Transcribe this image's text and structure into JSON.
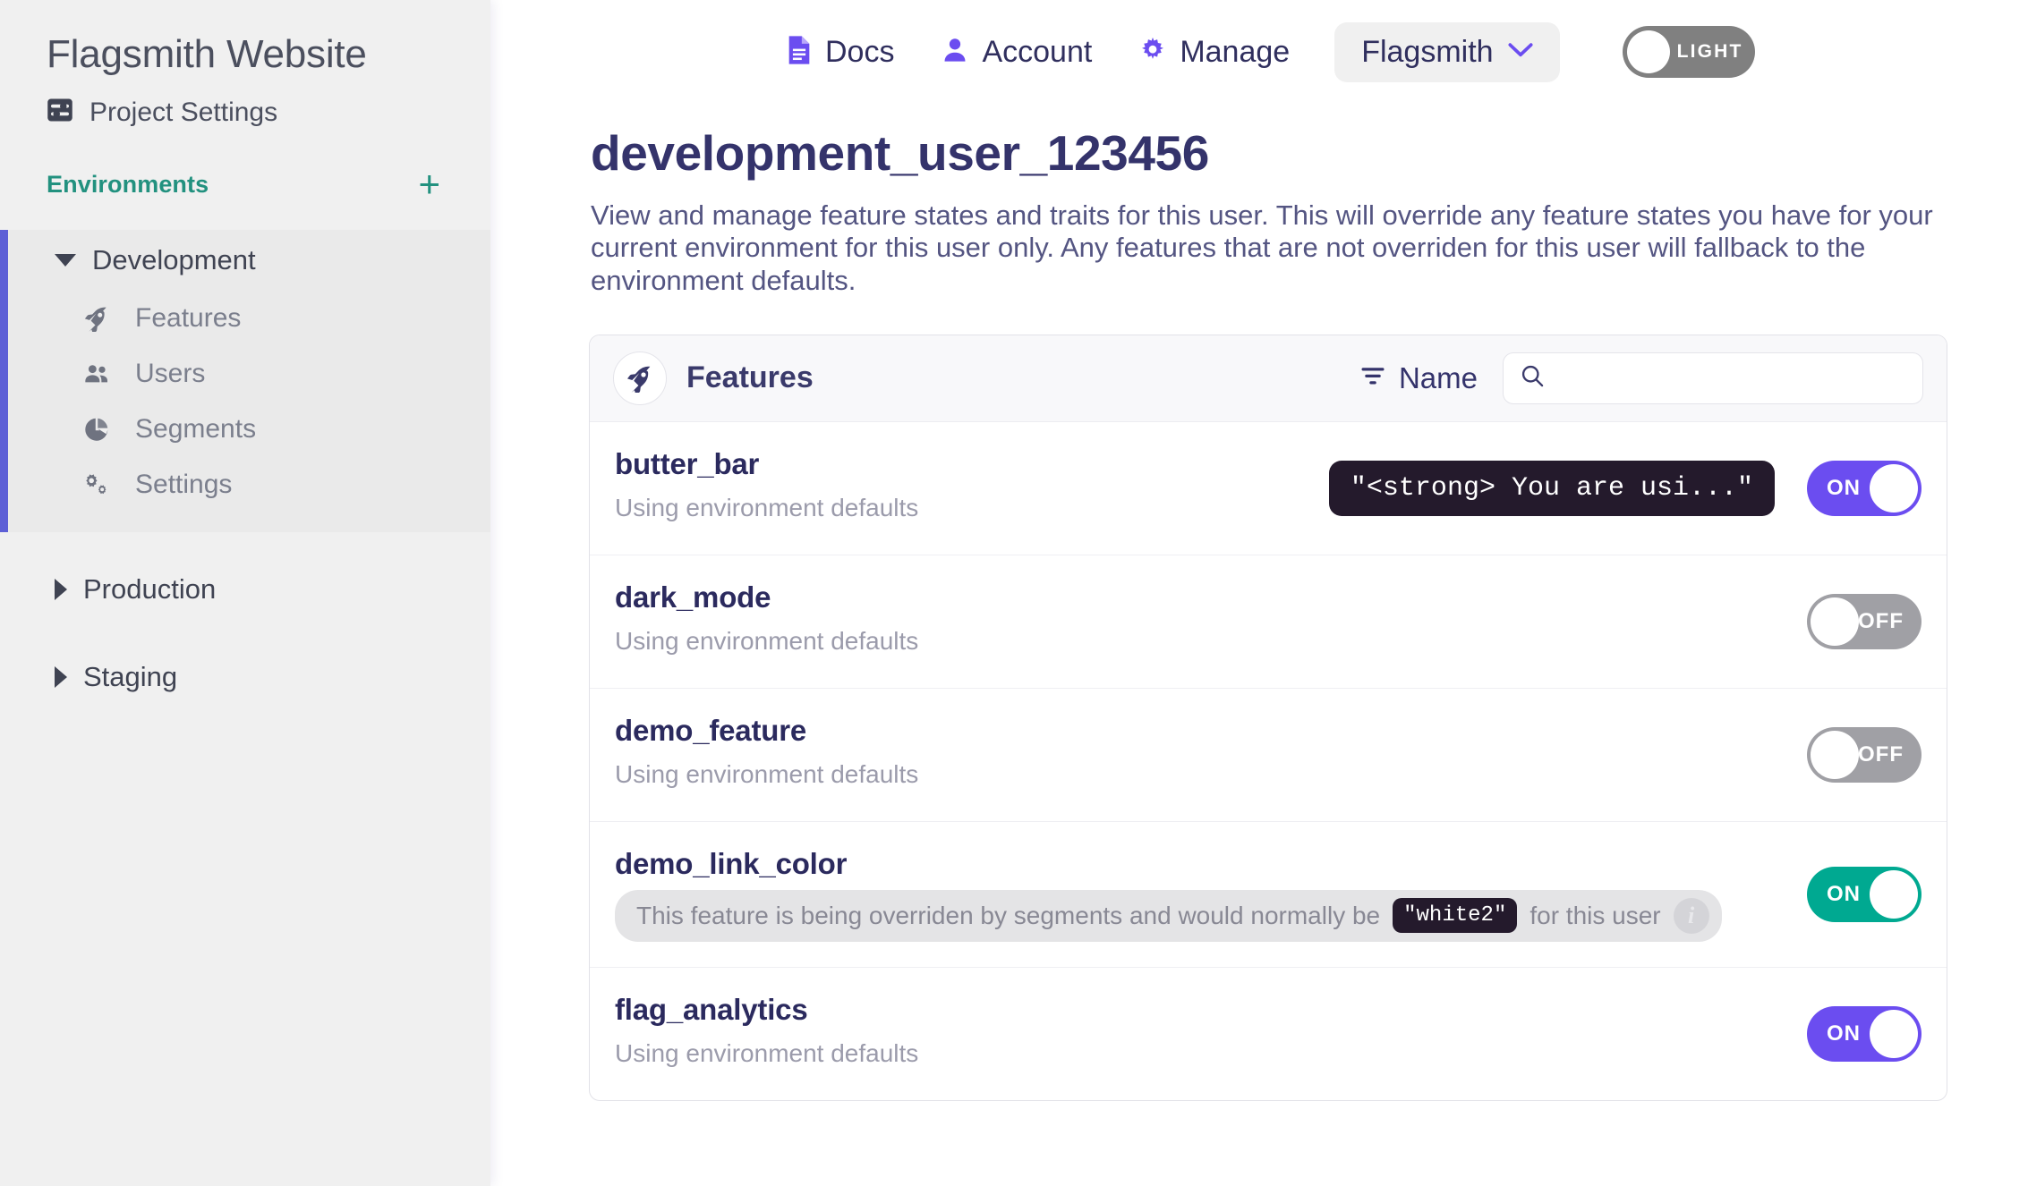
{
  "sidebar": {
    "project_title": "Flagsmith Website",
    "project_settings_label": "Project Settings",
    "project_settings_icon": "sliders-icon",
    "environments_label": "Environments",
    "add_environment_icon": "plus-icon",
    "environments": [
      {
        "name": "Development",
        "expanded": true,
        "active": true,
        "caret_icon": "caret-down-icon",
        "children": [
          {
            "label": "Features",
            "icon": "rocket-icon"
          },
          {
            "label": "Users",
            "icon": "people-icon"
          },
          {
            "label": "Segments",
            "icon": "pie-chart-icon"
          },
          {
            "label": "Settings",
            "icon": "gears-icon"
          }
        ]
      },
      {
        "name": "Production",
        "expanded": false,
        "active": false,
        "caret_icon": "caret-right-icon",
        "children": []
      },
      {
        "name": "Staging",
        "expanded": false,
        "active": false,
        "caret_icon": "caret-right-icon",
        "children": []
      }
    ]
  },
  "topnav": {
    "links": [
      {
        "label": "Docs",
        "icon": "document-icon"
      },
      {
        "label": "Account",
        "icon": "person-icon"
      },
      {
        "label": "Manage",
        "icon": "gear-icon"
      }
    ],
    "org_selector": {
      "label": "Flagsmith",
      "icon": "chevron-down-icon"
    },
    "theme_toggle": {
      "label": "LIGHT",
      "state": "off"
    }
  },
  "main": {
    "page_title": "development_user_123456",
    "page_description": "View and manage feature states and traits for this user. This will override any feature states you have for your current environment for this user only. Any features that are not overriden for this user will fallback to the environment defaults.",
    "panel": {
      "title": "Features",
      "title_icon": "rocket-icon",
      "sort": {
        "label": "Name",
        "icon": "filter-sort-icon"
      },
      "search": {
        "value": "",
        "placeholder": "",
        "icon": "search-icon"
      },
      "rows": [
        {
          "name": "butter_bar",
          "subtitle": "Using environment defaults",
          "value_badge": "\"<strong> You are usi...\"",
          "toggle": {
            "label": "ON",
            "state": "on",
            "color": "#6b4df0"
          }
        },
        {
          "name": "dark_mode",
          "subtitle": "Using environment defaults",
          "value_badge": "",
          "toggle": {
            "label": "OFF",
            "state": "off",
            "color": "#a0a0a5"
          }
        },
        {
          "name": "demo_feature",
          "subtitle": "Using environment defaults",
          "value_badge": "",
          "toggle": {
            "label": "OFF",
            "state": "off",
            "color": "#a0a0a5"
          }
        },
        {
          "name": "demo_link_color",
          "override": {
            "text_before": "This feature is being overriden by segments and would normally be",
            "value": "\"white2\"",
            "text_after": "for this user",
            "info_icon": "info-icon"
          },
          "toggle": {
            "label": "ON",
            "state": "on",
            "color": "#00a991"
          }
        },
        {
          "name": "flag_analytics",
          "subtitle": "Using environment defaults",
          "value_badge": "",
          "toggle": {
            "label": "ON",
            "state": "on",
            "color": "#6b4df0"
          }
        }
      ]
    }
  },
  "colors": {
    "accent_purple": "#6b4df0",
    "accent_teal": "#22917f",
    "toggle_teal": "#00a991",
    "sidebar_active_bar": "#5d5fd6",
    "title_navy": "#34336b"
  }
}
